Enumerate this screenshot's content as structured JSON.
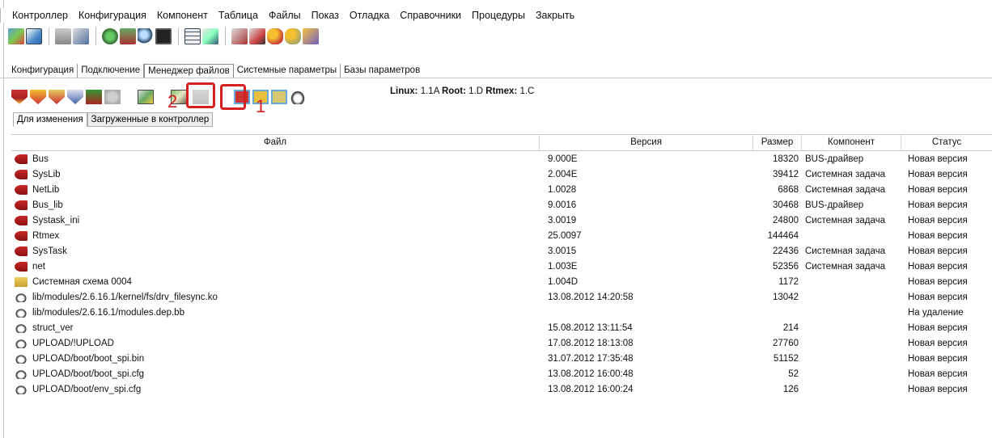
{
  "menubar": {
    "items": [
      "Контроллер",
      "Конфигурация",
      "Компонент",
      "Таблица",
      "Файлы",
      "Показ",
      "Отладка",
      "Справочники",
      "Процедуры",
      "Закрыть"
    ]
  },
  "tabs": [
    "Конфигурация",
    "Подключение",
    "Менеджер файлов",
    "Системные параметры",
    "Базы параметров"
  ],
  "active_tab": "Менеджер файлов",
  "annotations": {
    "num1": "1",
    "num2": "2"
  },
  "status": {
    "linux_label": "Linux:",
    "linux_value": "1.1A",
    "root_label": "Root:",
    "root_value": "1.D",
    "rtmex_label": "Rtmex:",
    "rtmex_value": "1.C"
  },
  "subtabs": [
    "Для изменения",
    "Загруженные в контроллер"
  ],
  "table": {
    "headers": [
      "Файл",
      "Версия",
      "Размер",
      "Компонент",
      "Статус"
    ],
    "rows": [
      {
        "icon": "tape",
        "file": "Bus",
        "version": "9.000E",
        "size": "18320",
        "component": "BUS-драйвер",
        "status": "Новая версия"
      },
      {
        "icon": "tape",
        "file": "SysLib",
        "version": "2.004E",
        "size": "39412",
        "component": "Системная задача",
        "status": "Новая версия"
      },
      {
        "icon": "tape",
        "file": "NetLib",
        "version": "1.0028",
        "size": "6868",
        "component": "Системная задача",
        "status": "Новая версия"
      },
      {
        "icon": "tape",
        "file": "Bus_lib",
        "version": "9.0016",
        "size": "30468",
        "component": "BUS-драйвер",
        "status": "Новая версия"
      },
      {
        "icon": "tape",
        "file": "Systask_ini",
        "version": "3.0019",
        "size": "24800",
        "component": "Системная задача",
        "status": "Новая версия"
      },
      {
        "icon": "tape",
        "file": "Rtmex",
        "version": "25.0097",
        "size": "144464",
        "component": "",
        "status": "Новая версия"
      },
      {
        "icon": "tape",
        "file": "SysTask",
        "version": "3.0015",
        "size": "22436",
        "component": "Системная задача",
        "status": "Новая версия"
      },
      {
        "icon": "tape",
        "file": "net",
        "version": "1.003E",
        "size": "52356",
        "component": "Системная задача",
        "status": "Новая версия"
      },
      {
        "icon": "folder",
        "file": "Системная схема 0004",
        "version": "1.004D",
        "size": "1172",
        "component": "",
        "status": "Новая версия"
      },
      {
        "icon": "linux",
        "file": "lib/modules/2.6.16.1/kernel/fs/drv_filesync.ko",
        "version": "13.08.2012 14:20:58",
        "size": "13042",
        "component": "",
        "status": "Новая версия"
      },
      {
        "icon": "linux",
        "file": "lib/modules/2.6.16.1/modules.dep.bb",
        "version": "",
        "size": "",
        "component": "",
        "status": "На удаление"
      },
      {
        "icon": "linux",
        "file": "struct_ver",
        "version": "15.08.2012 13:11:54",
        "size": "214",
        "component": "",
        "status": "Новая версия"
      },
      {
        "icon": "linux",
        "file": "UPLOAD/!UPLOAD",
        "version": "17.08.2012 18:13:08",
        "size": "27760",
        "component": "",
        "status": "Новая версия"
      },
      {
        "icon": "linux",
        "file": "UPLOAD/boot/boot_spi.bin",
        "version": "31.07.2012 17:35:48",
        "size": "51152",
        "component": "",
        "status": "Новая версия"
      },
      {
        "icon": "linux",
        "file": "UPLOAD/boot/boot_spi.cfg",
        "version": "13.08.2012 16:00:48",
        "size": "52",
        "component": "",
        "status": "Новая версия"
      },
      {
        "icon": "linux",
        "file": "UPLOAD/boot/env_spi.cfg",
        "version": "13.08.2012 16:00:24",
        "size": "126",
        "component": "",
        "status": "Новая версия"
      }
    ]
  },
  "colors": {
    "annotation": "#d62020",
    "delete_status": "#d62020"
  }
}
